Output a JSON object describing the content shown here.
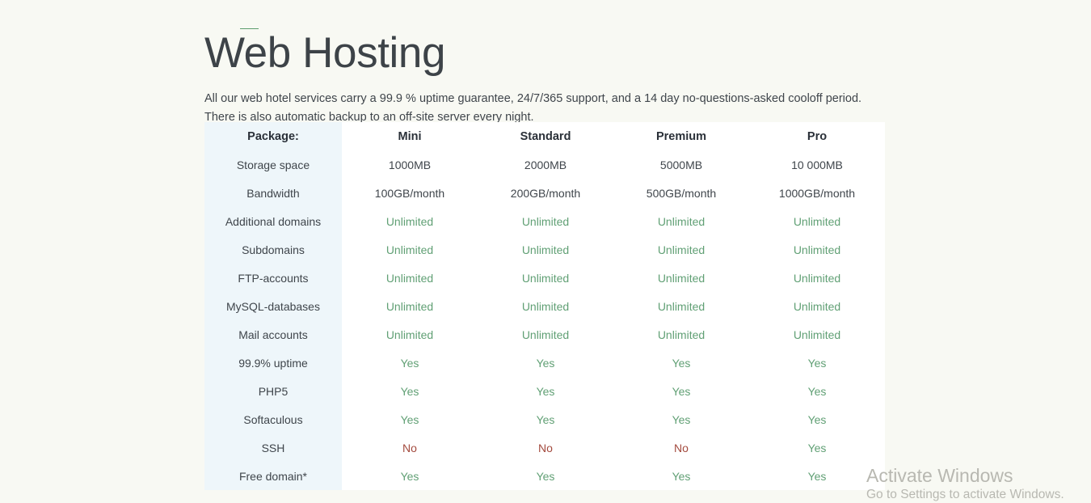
{
  "page": {
    "title": "Web Hosting",
    "intro": "All our web hotel services carry a 99.9 % uptime guarantee, 24/7/365 support, and a 14 day no-questions-asked cooloff period. There is also automatic backup to an off-site server every night."
  },
  "colors": {
    "page_background": "#f8f9f3",
    "table_background": "#ffffff",
    "label_column_background": "#eef6fa",
    "text": "#3f454b",
    "heading": "#3d4348",
    "positive": "#61a075",
    "negative": "#a34a3e"
  },
  "table": {
    "label_header": "Package:",
    "columns": [
      "Mini",
      "Standard",
      "Premium",
      "Pro"
    ],
    "rows": [
      {
        "label": "Storage space",
        "kind": "text",
        "values": [
          "1000MB",
          "2000MB",
          "5000MB",
          "10 000MB"
        ]
      },
      {
        "label": "Bandwidth",
        "kind": "text",
        "values": [
          "100GB/month",
          "200GB/month",
          "500GB/month",
          "1000GB/month"
        ]
      },
      {
        "label": "Additional domains",
        "kind": "unlimited",
        "values": [
          "Unlimited",
          "Unlimited",
          "Unlimited",
          "Unlimited"
        ]
      },
      {
        "label": "Subdomains",
        "kind": "unlimited",
        "values": [
          "Unlimited",
          "Unlimited",
          "Unlimited",
          "Unlimited"
        ]
      },
      {
        "label": "FTP-accounts",
        "kind": "unlimited",
        "values": [
          "Unlimited",
          "Unlimited",
          "Unlimited",
          "Unlimited"
        ]
      },
      {
        "label": "MySQL-databases",
        "kind": "unlimited",
        "values": [
          "Unlimited",
          "Unlimited",
          "Unlimited",
          "Unlimited"
        ]
      },
      {
        "label": "Mail accounts",
        "kind": "unlimited",
        "values": [
          "Unlimited",
          "Unlimited",
          "Unlimited",
          "Unlimited"
        ]
      },
      {
        "label": "99.9% uptime",
        "kind": "boolean",
        "values": [
          "Yes",
          "Yes",
          "Yes",
          "Yes"
        ]
      },
      {
        "label": "PHP5",
        "kind": "boolean",
        "values": [
          "Yes",
          "Yes",
          "Yes",
          "Yes"
        ]
      },
      {
        "label": "Softaculous",
        "kind": "boolean",
        "values": [
          "Yes",
          "Yes",
          "Yes",
          "Yes"
        ]
      },
      {
        "label": "SSH",
        "kind": "boolean",
        "values": [
          "No",
          "No",
          "No",
          "Yes"
        ]
      },
      {
        "label": "Free domain*",
        "kind": "boolean",
        "values": [
          "Yes",
          "Yes",
          "Yes",
          "Yes"
        ]
      }
    ]
  },
  "watermark": {
    "title": "Activate Windows",
    "subtitle": "Go to Settings to activate Windows."
  }
}
